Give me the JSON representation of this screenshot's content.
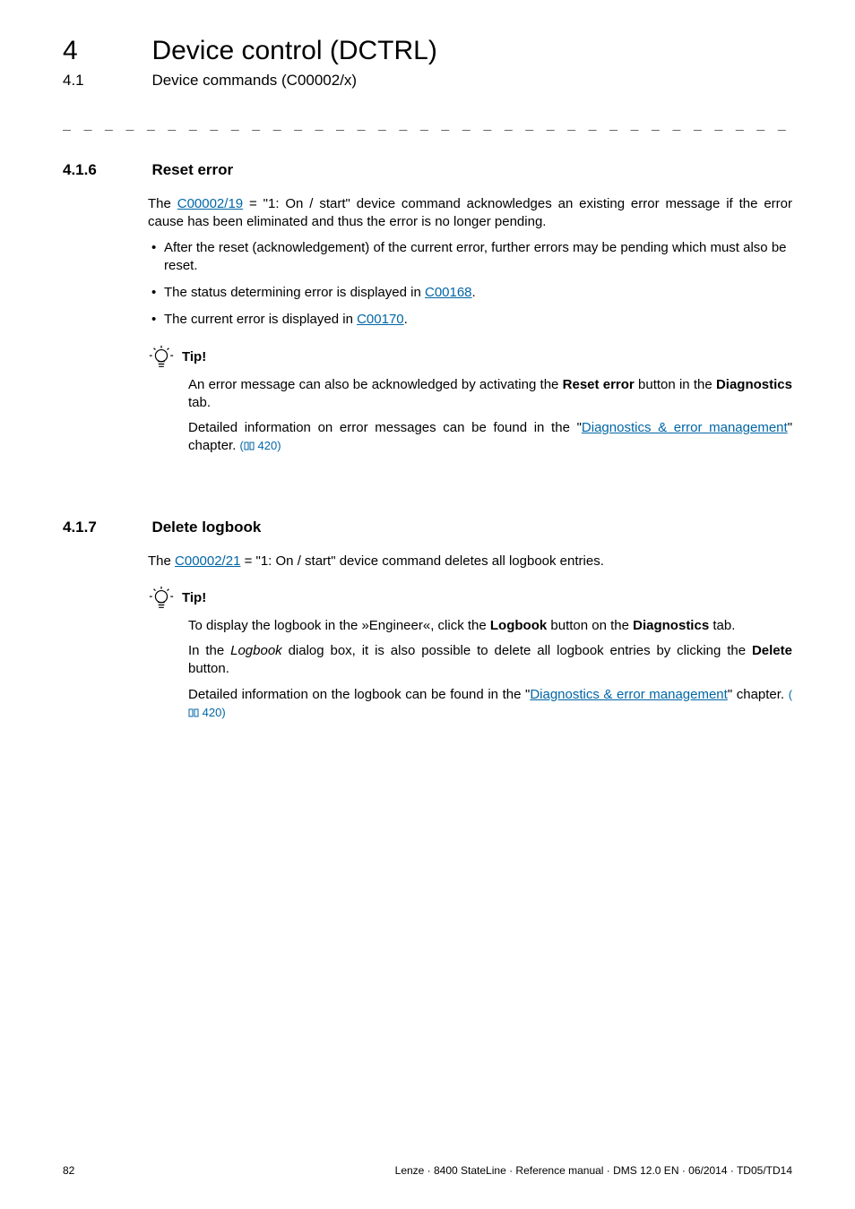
{
  "header": {
    "chapter_num": "4",
    "chapter_title": "Device control (DCTRL)",
    "sub_num": "4.1",
    "sub_title": "Device commands (C00002/x)"
  },
  "sections": [
    {
      "num": "4.1.6",
      "title": "Reset error",
      "intro_pre": "The ",
      "intro_link": "C00002/19",
      "intro_post": " = \"1: On / start\" device command acknowledges an existing error message if the error cause has been eliminated and thus the error is no longer pending.",
      "bullets": [
        {
          "pre": "After the reset (acknowledgement) of the current error, further errors may be pending which must also be reset."
        },
        {
          "pre": "The status determining error is displayed in ",
          "link": "C00168",
          "post": "."
        },
        {
          "pre": "The current error is displayed in ",
          "link": "C00170",
          "post": "."
        }
      ],
      "tip": {
        "label": "Tip!",
        "paras": [
          {
            "text_pre": "An error message can also be acknowledged by activating the ",
            "bold1": "Reset error",
            "mid": " button in the ",
            "bold2": "Diagnostics",
            "post": " tab."
          },
          {
            "text_pre": "Detailed information on error messages can be found in the \"",
            "link": "Diagnostics & error management",
            "post_link": "\" chapter. ",
            "pageref": "420"
          }
        ]
      }
    },
    {
      "num": "4.1.7",
      "title": "Delete logbook",
      "intro_pre": "The ",
      "intro_link": "C00002/21",
      "intro_post": " = \"1: On / start\" device command deletes all logbook entries.",
      "tip": {
        "label": "Tip!",
        "paras": [
          {
            "text_pre": "To display the logbook in the »Engineer«, click the ",
            "bold1": "Logbook",
            "mid": " button on the ",
            "bold2": "Diagnostics",
            "post": " tab."
          },
          {
            "text_pre": "In the ",
            "italic1": "Logbook",
            "mid_i": " dialog box, it is also possible to delete all logbook entries by clicking the ",
            "bold1": "Delete",
            "post": " button."
          },
          {
            "text_pre": "Detailed information on the logbook can be found in the \"",
            "link": "Diagnostics & error management",
            "post_link": "\" chapter. ",
            "pageref": "420"
          }
        ]
      }
    }
  ],
  "footer": {
    "page": "82",
    "text": "Lenze · 8400 StateLine · Reference manual · DMS 12.0 EN · 06/2014 · TD05/TD14"
  },
  "icons": {
    "tip": "lightbulb-icon",
    "book": "book-icon"
  }
}
